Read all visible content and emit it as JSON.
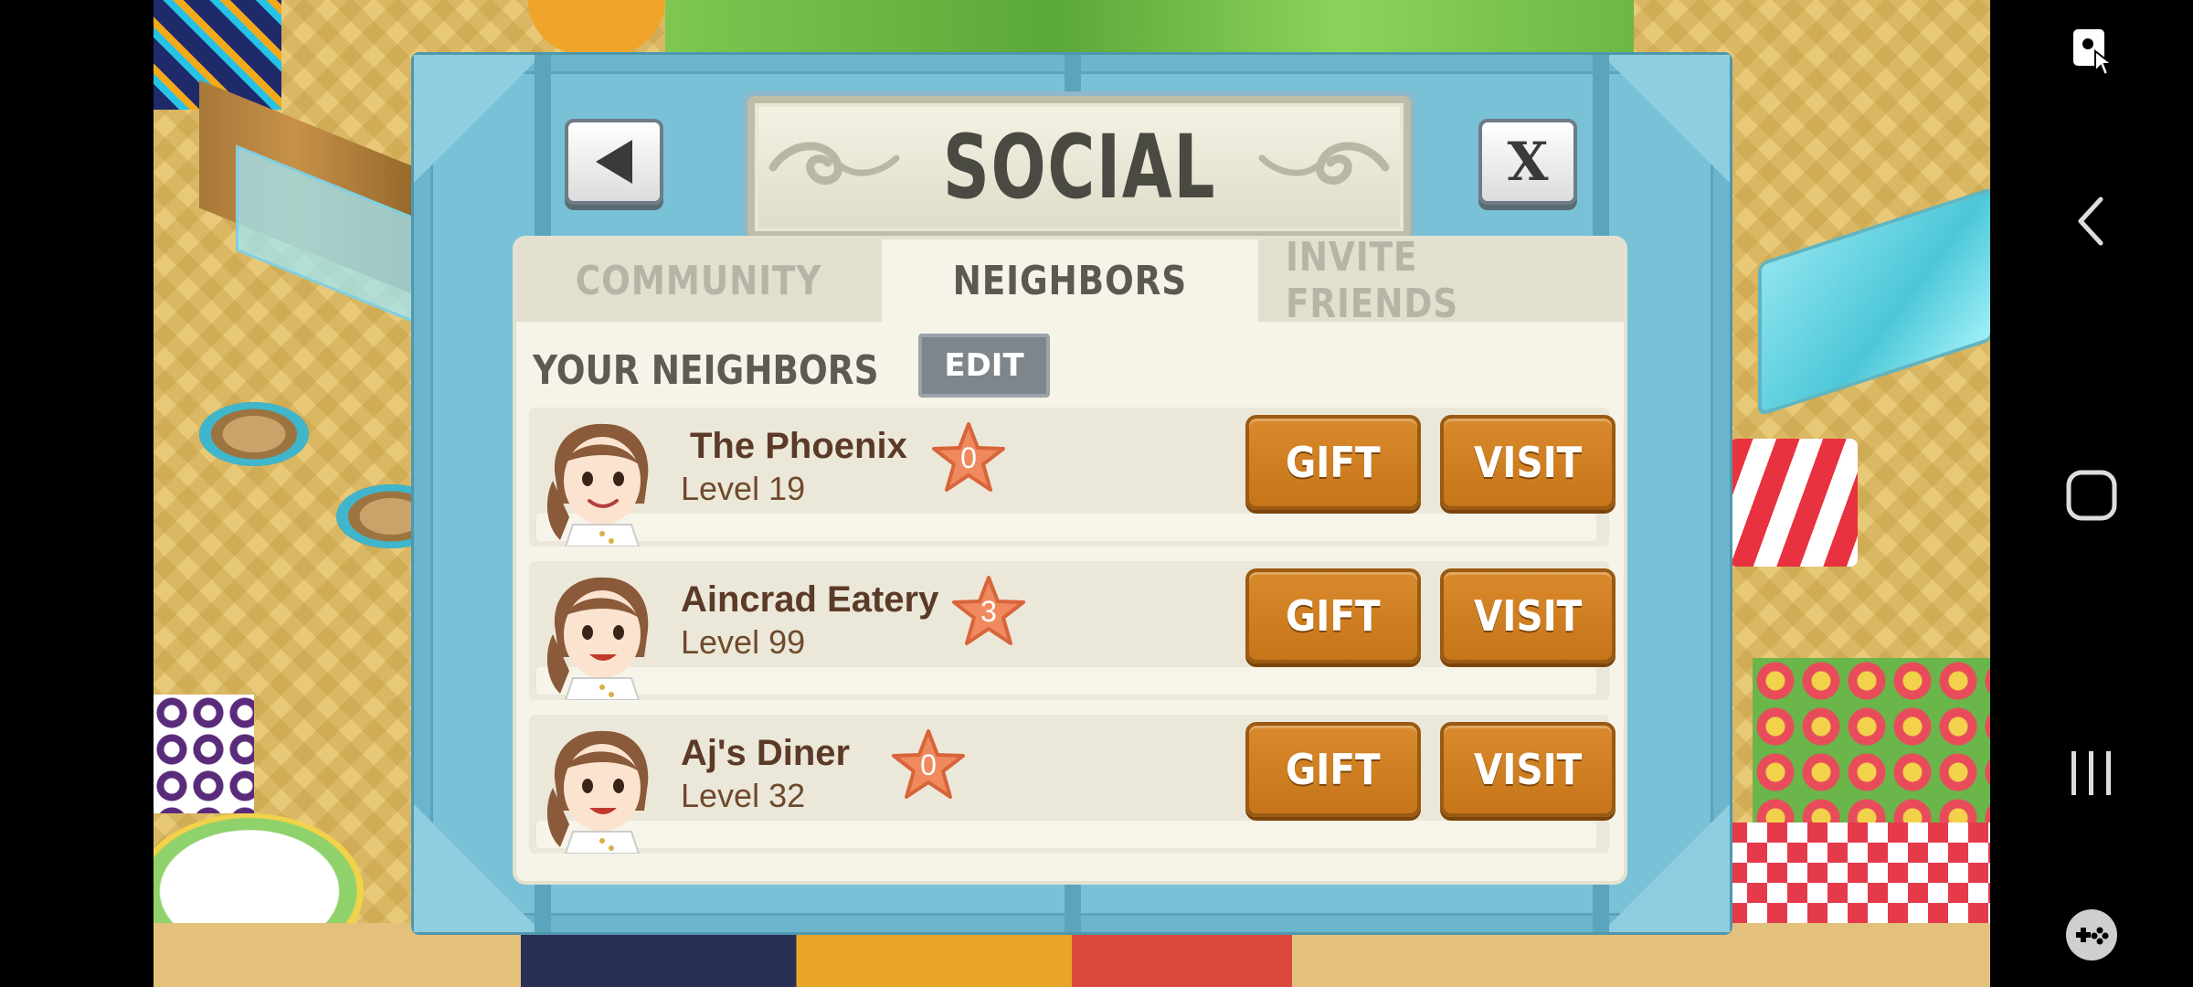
{
  "dialog": {
    "title": "SOCIAL",
    "close_label": "X"
  },
  "tabs": [
    {
      "label": "COMMUNITY",
      "active": false
    },
    {
      "label": "NEIGHBORS",
      "active": true
    },
    {
      "label": "INVITE FRIENDS",
      "active": false
    }
  ],
  "neighbors_section": {
    "label": "YOUR NEIGHBORS",
    "edit_label": "EDIT"
  },
  "neighbors": [
    {
      "name": "The Phoenix",
      "level": "Level 19",
      "stars": "0",
      "gift_label": "GIFT",
      "visit_label": "VISIT"
    },
    {
      "name": "Aincrad Eatery",
      "level": "Level 99",
      "stars": "3",
      "gift_label": "GIFT",
      "visit_label": "VISIT"
    },
    {
      "name": "Aj's Diner",
      "level": "Level 32",
      "stars": "0",
      "gift_label": "GIFT",
      "visit_label": "VISIT"
    }
  ],
  "colors": {
    "dialog_frame": "#6bb6cd",
    "panel": "#f6f3e8",
    "action_button": "#d98a2c",
    "star": "#f0805a"
  },
  "nav_bar": {
    "icons": [
      "accessibility-icon",
      "back-chevron-icon",
      "home-square-icon",
      "recents-icon",
      "game-controller-icon"
    ]
  }
}
